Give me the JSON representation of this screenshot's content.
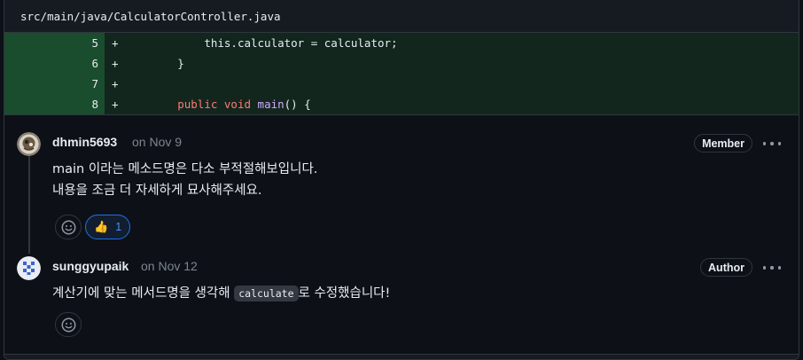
{
  "file": {
    "path": "src/main/java/CalculatorController.java"
  },
  "diff": {
    "lines": [
      {
        "num": "5",
        "sign": "+",
        "indent": "            ",
        "parts": [
          {
            "t": "this.calculator = calculator;",
            "c": "txt"
          }
        ]
      },
      {
        "num": "6",
        "sign": "+",
        "indent": "        ",
        "parts": [
          {
            "t": "}",
            "c": "txt"
          }
        ]
      },
      {
        "num": "7",
        "sign": "+",
        "indent": "",
        "parts": []
      },
      {
        "num": "8",
        "sign": "+",
        "indent": "        ",
        "parts": [
          {
            "t": "public",
            "c": "kw"
          },
          {
            "t": " ",
            "c": "txt"
          },
          {
            "t": "void",
            "c": "kw"
          },
          {
            "t": " ",
            "c": "txt"
          },
          {
            "t": "main",
            "c": "fn"
          },
          {
            "t": "() {",
            "c": "txt"
          }
        ]
      }
    ]
  },
  "comments": [
    {
      "author": "dhmin5693",
      "date": "on Nov 9",
      "badge": "Member",
      "body_line1": "main 이라는 메소드명은 다소 부적절해보입니다.",
      "body_line2": "내용을 조금 더 자세하게 묘사해주세요.",
      "reaction_icon": "smiley-icon",
      "thumbs": {
        "emoji": "👍",
        "count": "1"
      }
    },
    {
      "author": "sunggyupaik",
      "date": "on Nov 12",
      "badge": "Author",
      "body_before": "계산기에 맞는 메서드명을 생각해 ",
      "body_code": "calculate",
      "body_after": "로 수정했습니다!",
      "reaction_icon": "smiley-icon"
    }
  ],
  "colors": {
    "added_line": "#12261e",
    "added_gutter": "#1a4d2e",
    "accent": "#4493f8",
    "background": "#0d1117"
  }
}
